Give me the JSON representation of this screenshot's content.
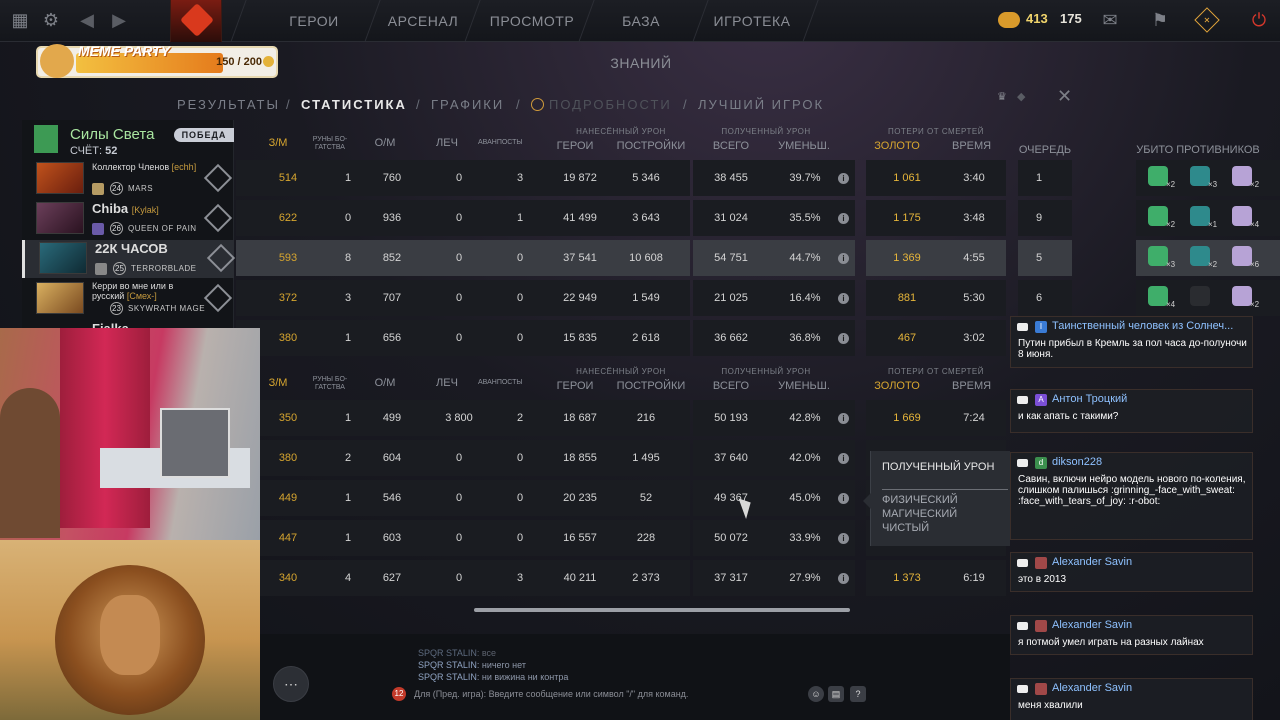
{
  "top_nav": {
    "items": [
      "ГЕРОИ",
      "АРСЕНАЛ",
      "ПРОСМОТР",
      "БАЗА ЗНАНИЙ",
      "ИГРОТЕКА"
    ],
    "gold": "413",
    "shards": "175"
  },
  "event_banner": {
    "title": "MEME PARTY",
    "progress_text": "150 / 200",
    "progress_fraction": 0.75
  },
  "sub_nav": {
    "items": [
      "РЕЗУЛЬТАТЫ",
      "СТАТИСТИКА",
      "ГРАФИКИ",
      "ПОДРОБНОСТИ",
      "ЛУЧШИЙ ИГРОК"
    ],
    "active": "СТАТИСТИКА",
    "separator": "/"
  },
  "team": {
    "name": "Силы Света",
    "score_label": "СЧЁТ:",
    "score": "52",
    "result_badge": "ПОБЕДА"
  },
  "players": [
    {
      "name": "Коллектор Членов",
      "tag": "[echh]",
      "level": "24",
      "hero": "MARS"
    },
    {
      "name": "Chiba",
      "tag": "[Kylak]",
      "level": "26",
      "hero": "QUEEN OF PAIN"
    },
    {
      "name": "22К ЧАСОВ",
      "tag": "",
      "level": "25",
      "hero": "TERRORBLADE"
    },
    {
      "name": "Керри во мне или в русский",
      "tag": "[Смех-]",
      "level": "23",
      "hero": "SKYWRATH MAGE"
    },
    {
      "name": "Fialka",
      "tag": "",
      "level": "",
      "hero": ""
    }
  ],
  "headers": {
    "zm": "З/М",
    "runes": "РУНЫ БО-ГАТСТВА",
    "om": "О/М",
    "heal": "ЛЕЧ",
    "vanguard": "АВАНПОСТЫ",
    "dealt_group": "НАНЕСЁННЫЙ УРОН",
    "heroes": "ГЕРОИ",
    "buildings": "ПОСТРОЙКИ",
    "taken_group": "ПОЛУЧЕННЫЙ УРОН",
    "total": "ВСЕГО",
    "reduced": "УМЕНЬШ.",
    "death_group": "ПОТЕРИ ОТ СМЕРТЕЙ",
    "gold": "ЗОЛОТО",
    "time": "ВРЕМЯ",
    "order": "ОЧЕРЕДЬ",
    "kills": "УБИТО ПРОТИВНИКОВ"
  },
  "radiant_rows": [
    {
      "zm": "514",
      "runes": "1",
      "om": "760",
      "heal": "0",
      "vanguard": "3",
      "heroes": "19 872",
      "buildings": "5 346",
      "total": "38 455",
      "reduced": "39.7%",
      "gold": "1 061",
      "time": "3:40",
      "order": "1"
    },
    {
      "zm": "622",
      "runes": "0",
      "om": "936",
      "heal": "0",
      "vanguard": "1",
      "heroes": "41 499",
      "buildings": "3 643",
      "total": "31 024",
      "reduced": "35.5%",
      "gold": "1 175",
      "time": "3:48",
      "order": "9"
    },
    {
      "zm": "593",
      "runes": "8",
      "om": "852",
      "heal": "0",
      "vanguard": "0",
      "heroes": "37 541",
      "buildings": "10 608",
      "total": "54 751",
      "reduced": "44.7%",
      "gold": "1 369",
      "time": "4:55",
      "order": "5"
    },
    {
      "zm": "372",
      "runes": "3",
      "om": "707",
      "heal": "0",
      "vanguard": "0",
      "heroes": "22 949",
      "buildings": "1 549",
      "total": "21 025",
      "reduced": "16.4%",
      "gold": "881",
      "time": "5:30",
      "order": "6"
    },
    {
      "zm": "380",
      "runes": "1",
      "om": "656",
      "heal": "0",
      "vanguard": "0",
      "heroes": "15 835",
      "buildings": "2 618",
      "total": "36 662",
      "reduced": "36.8%",
      "gold": "467",
      "time": "3:02",
      "order": ""
    }
  ],
  "dire_rows": [
    {
      "zm": "350",
      "runes": "1",
      "om": "499",
      "heal": "3 800",
      "vanguard": "2",
      "heroes": "18 687",
      "buildings": "216",
      "total": "50 193",
      "reduced": "42.8%",
      "gold": "1 669",
      "time": "7:24"
    },
    {
      "zm": "380",
      "runes": "2",
      "om": "604",
      "heal": "0",
      "vanguard": "0",
      "heroes": "18 855",
      "buildings": "1 495",
      "total": "37 640",
      "reduced": "42.0%",
      "gold": "",
      "time": ""
    },
    {
      "zm": "449",
      "runes": "1",
      "om": "546",
      "heal": "0",
      "vanguard": "0",
      "heroes": "20 235",
      "buildings": "52",
      "total": "49 367",
      "reduced": "45.0%",
      "gold": "",
      "time": ""
    },
    {
      "zm": "447",
      "runes": "1",
      "om": "603",
      "heal": "0",
      "vanguard": "0",
      "heroes": "16 557",
      "buildings": "228",
      "total": "50 072",
      "reduced": "33.9%",
      "gold": "",
      "time": ""
    },
    {
      "zm": "340",
      "runes": "4",
      "om": "627",
      "heal": "0",
      "vanguard": "3",
      "heroes": "40 211",
      "buildings": "2 373",
      "total": "37 317",
      "reduced": "27.9%",
      "gold": "1 373",
      "time": "6:19"
    }
  ],
  "kills": [
    [
      "×2",
      "×3",
      "×2"
    ],
    [
      "×2",
      "×1",
      "×4"
    ],
    [
      "×3",
      "×2",
      "×6"
    ],
    [
      "×4",
      "",
      "×2"
    ]
  ],
  "tooltip": {
    "title": "ПОЛУЧЕННЫЙ УРОН",
    "lines": [
      "ФИЗИЧЕСКИЙ",
      "МАГИЧЕСКИЙ",
      "ЧИСТЫЙ"
    ]
  },
  "game_chat": {
    "lines": [
      {
        "name": "SPQR STALIN",
        "text": ": все"
      },
      {
        "name": "SPQR STALIN",
        "text": ": ничего нет"
      },
      {
        "name": "SPQR STALIN",
        "text": ": ни вижина ни контра"
      }
    ],
    "unread": "12",
    "placeholder": "Для (Пред. игра): Введите сообщение или символ \"/\" для команд."
  },
  "yt_chat": [
    {
      "author": "Таинственный человек из Солнеч...",
      "avatar": "I",
      "color": "#3a7bd5",
      "text": "Путин прибыл в Кремль за пол часа до-полуночи 8 июня."
    },
    {
      "author": "Антон Троцкий",
      "avatar": "А",
      "color": "#7b4fd6",
      "text": "и как апать с такими?"
    },
    {
      "author": "dikson228",
      "avatar": "d",
      "color": "#3c8f4e",
      "text": "Савин, включи нейро модель нового по-коления, слишком палишься :grinning_-face_with_sweat: :face_with_tears_of_joy: :r-obot:"
    },
    {
      "author": "Alexander Savin",
      "avatar": "",
      "color": "#a04848",
      "text": "это в 2013"
    },
    {
      "author": "Alexander Savin",
      "avatar": "",
      "color": "#a04848",
      "text": "я потмой умел играть на разных лайнах"
    },
    {
      "author": "Alexander Savin",
      "avatar": "",
      "color": "#a04848",
      "text": "меня хвалили"
    }
  ],
  "colors": {
    "accent_gold": "#d6a52f",
    "team_green": "#a9e6a0",
    "yt_name": "#8ec1ff"
  }
}
